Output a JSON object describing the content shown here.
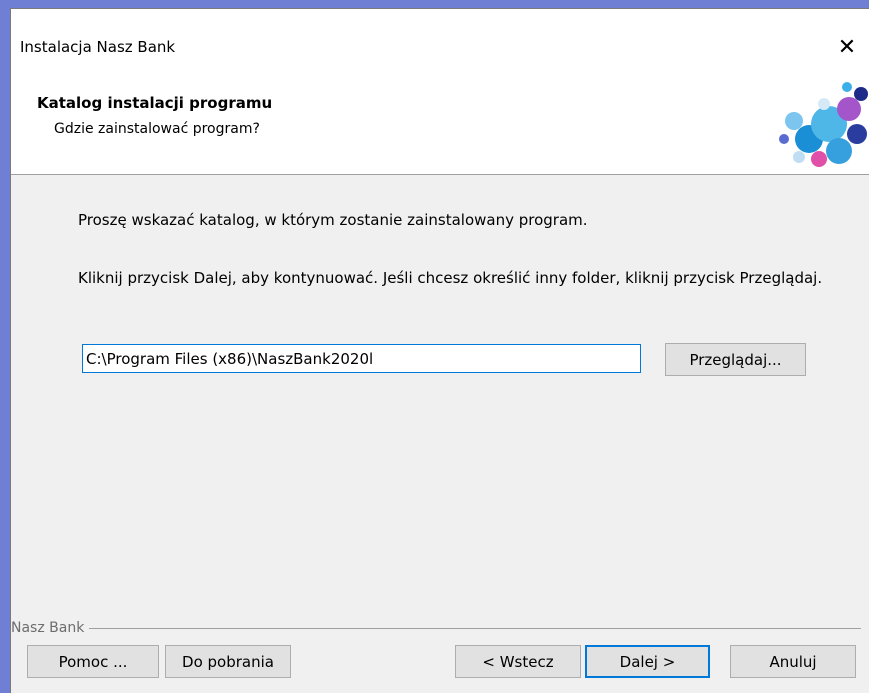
{
  "window": {
    "title": "Instalacja Nasz Bank",
    "close_glyph": "✕"
  },
  "header": {
    "title": "Katalog instalacji programu",
    "subtitle": "Gdzie zainstalować program?",
    "logo_icon": "colorful-bubbles-logo"
  },
  "content": {
    "instruction": "Proszę wskazać katalog, w którym zostanie zainstalowany program.",
    "hint": "Kliknij przycisk Dalej, aby kontynuować. Jeśli chcesz określić inny folder, kliknij przycisk Przeglądaj.",
    "path_value": "C:\\Program Files (x86)\\NaszBank2020l",
    "browse_label": "Przeglądaj..."
  },
  "footer": {
    "group_label": "Nasz Bank",
    "help_label": "Pomoc ...",
    "download_label": "Do pobrania",
    "back_label": "< Wstecz",
    "next_label": "Dalej >",
    "cancel_label": "Anuluj"
  },
  "colors": {
    "accent": "#0078d7",
    "desktop": "#6f7fd4",
    "dialog_bg": "#f0f0f0"
  }
}
